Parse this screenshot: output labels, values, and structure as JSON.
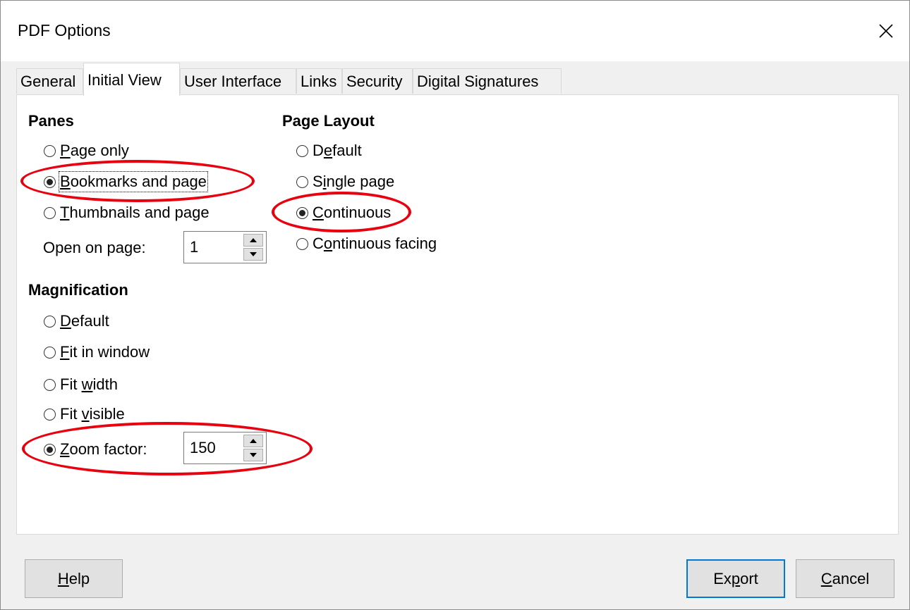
{
  "window": {
    "title": "PDF Options",
    "close_icon": "close-icon"
  },
  "tabs": [
    {
      "label": "General",
      "active": false
    },
    {
      "label": "Initial View",
      "active": true
    },
    {
      "label": "User Interface",
      "active": false
    },
    {
      "label": "Links",
      "active": false
    },
    {
      "label": "Security",
      "active": false
    },
    {
      "label": "Digital Signatures",
      "active": false
    }
  ],
  "panes": {
    "heading": "Panes",
    "options": [
      {
        "pre": "",
        "key": "P",
        "rest": "age only",
        "checked": false
      },
      {
        "pre": "",
        "key": "B",
        "rest": "ookmarks and page",
        "checked": true
      },
      {
        "pre": "",
        "key": "T",
        "rest": "humbnails and page",
        "checked": false
      }
    ],
    "open_on_page": {
      "pre": "Open on pa",
      "key": "g",
      "rest": "e:",
      "value": "1"
    }
  },
  "magnification": {
    "heading": "Magnification",
    "options": [
      {
        "pre": "",
        "key": "D",
        "rest": "efault",
        "checked": false
      },
      {
        "pre": "",
        "key": "F",
        "rest": "it in window",
        "checked": false
      },
      {
        "pre": "Fit ",
        "key": "w",
        "rest": "idth",
        "checked": false
      },
      {
        "pre": "Fit ",
        "key": "v",
        "rest": "isible",
        "checked": false
      },
      {
        "pre": "",
        "key": "Z",
        "rest": "oom factor:",
        "checked": true
      }
    ],
    "zoom_value": "150"
  },
  "page_layout": {
    "heading": "Page Layout",
    "options": [
      {
        "pre": "D",
        "key": "e",
        "rest": "fault",
        "checked": false
      },
      {
        "pre": "S",
        "key": "i",
        "rest": "ngle page",
        "checked": false
      },
      {
        "pre": "",
        "key": "C",
        "rest": "ontinuous",
        "checked": true
      },
      {
        "pre": "C",
        "key": "o",
        "rest": "ntinuous facing",
        "checked": false
      }
    ]
  },
  "buttons": {
    "help": {
      "pre": "",
      "key": "H",
      "rest": "elp"
    },
    "export": {
      "pre": "Ex",
      "key": "p",
      "rest": "ort"
    },
    "cancel": {
      "pre": "",
      "key": "C",
      "rest": "ancel"
    }
  },
  "annotation_color": "#e8000f",
  "accent_color": "#0078d7"
}
